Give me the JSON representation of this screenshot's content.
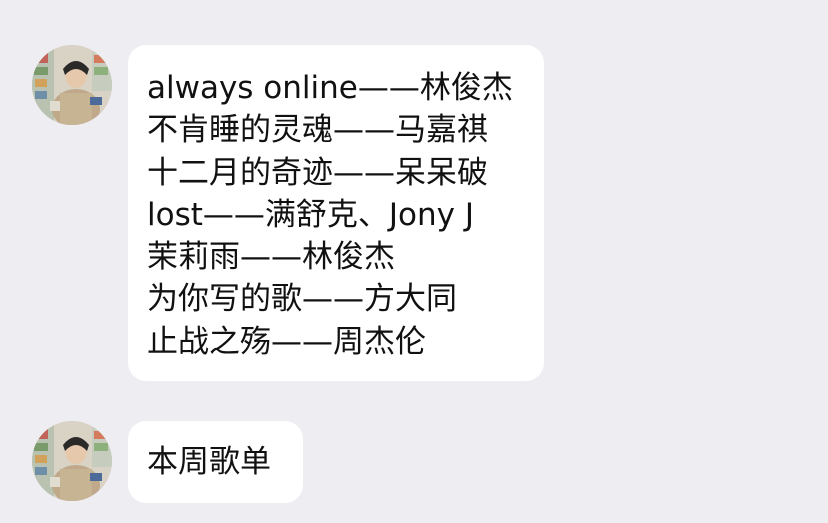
{
  "messages": [
    {
      "avatar_icon": "user-avatar-photo",
      "lines": [
        "always online——林俊杰",
        "不肯睡的灵魂——马嘉祺",
        "十二月的奇迹——呆呆破",
        "lost——满舒克、Jony J",
        "茉莉雨——林俊杰",
        "为你写的歌——方大同",
        "止战之殇——周杰伦"
      ]
    },
    {
      "avatar_icon": "user-avatar-photo",
      "text": "本周歌单"
    }
  ],
  "colors": {
    "background": "#EDEDF2",
    "bubble": "#FFFFFF",
    "text": "#111111"
  }
}
